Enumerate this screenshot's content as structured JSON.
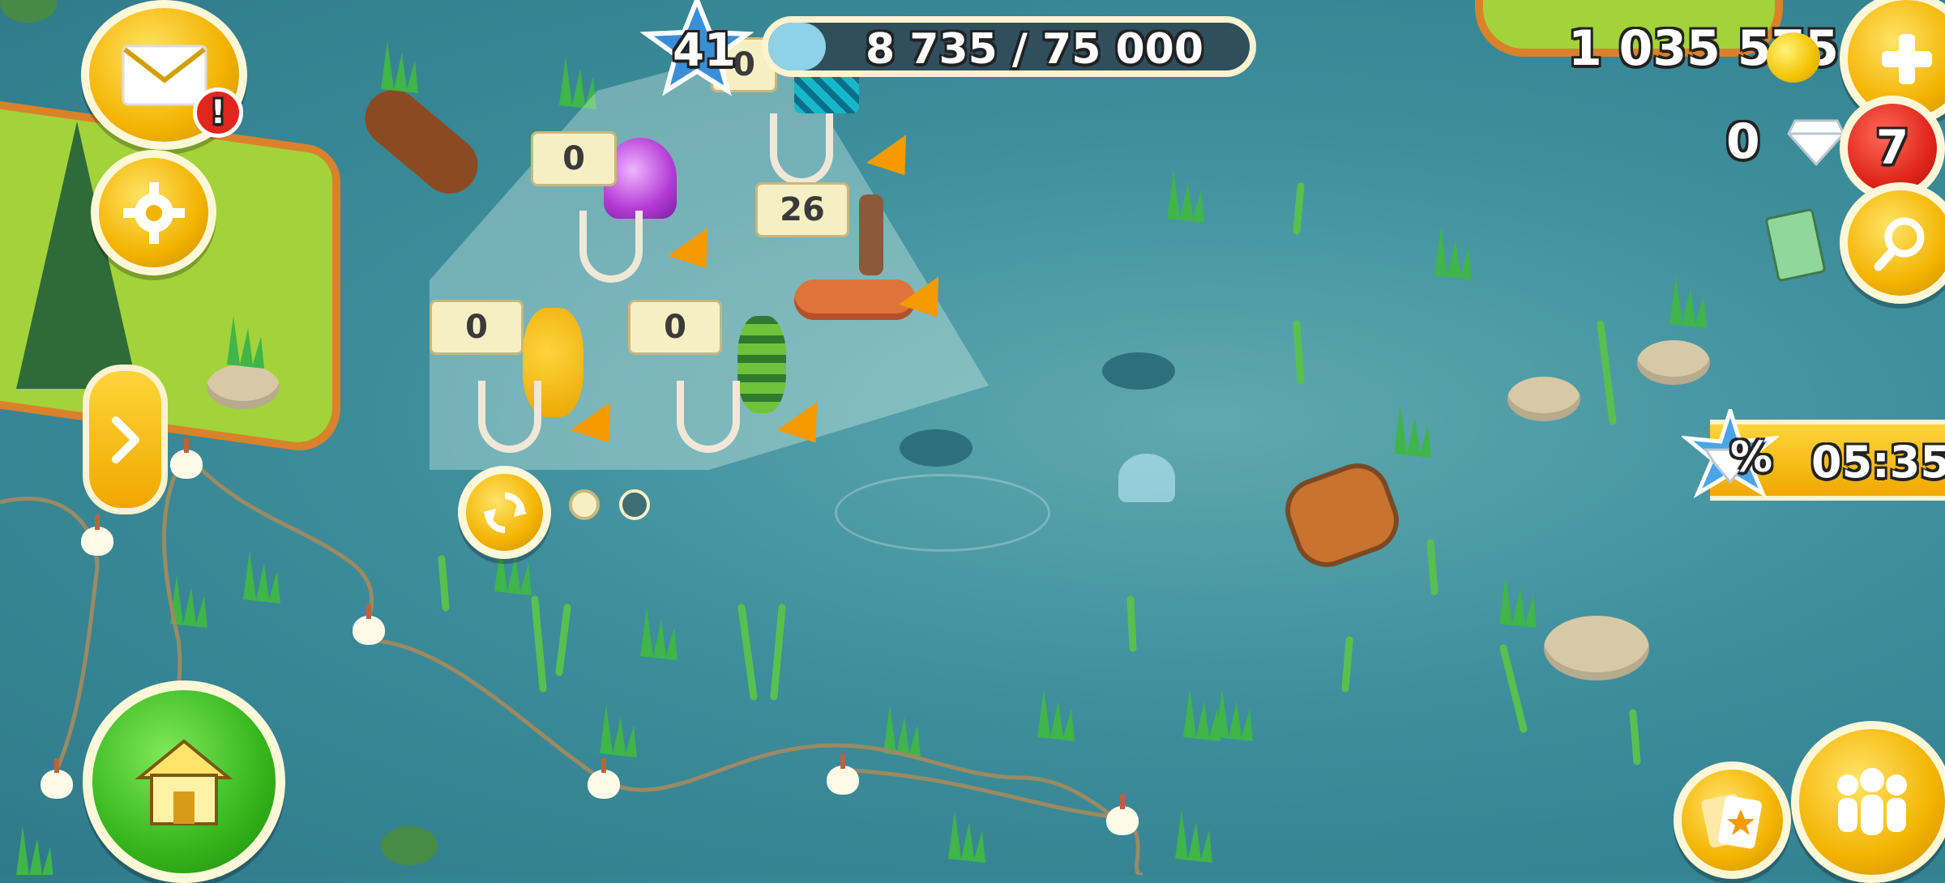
{
  "xp": {
    "level": "41",
    "current": "8 735 / 75 000"
  },
  "coins": {
    "amount": "1 035 575"
  },
  "diamonds": {
    "amount": "0"
  },
  "notifications": {
    "count": "7"
  },
  "mail": {
    "alert": "!"
  },
  "sale": {
    "timer": "05:35",
    "badge_symbol": "%"
  },
  "bait": [
    {
      "name": "feather-blue-lure",
      "count": "0"
    },
    {
      "name": "purple-feather-lure",
      "count": "0"
    },
    {
      "name": "worm-bait",
      "count": "26"
    },
    {
      "name": "yellow-lure",
      "count": "0"
    },
    {
      "name": "green-striped-lure",
      "count": "0"
    }
  ],
  "bait_pages": {
    "total": 2,
    "active": 0
  },
  "icons": {
    "mail": "envelope-icon",
    "settings": "gear-icon",
    "expand": "chevron-right-icon",
    "home": "house-icon",
    "add_coins": "plus-icon",
    "search": "magnifier-icon",
    "refresh": "refresh-icon",
    "friends": "people-icon",
    "cards": "cards-icon"
  },
  "colors": {
    "water": "#3e8e9c",
    "gold": "#f3b300",
    "grass": "#a3d33a",
    "red": "#e0261d",
    "green": "#35b51c"
  }
}
